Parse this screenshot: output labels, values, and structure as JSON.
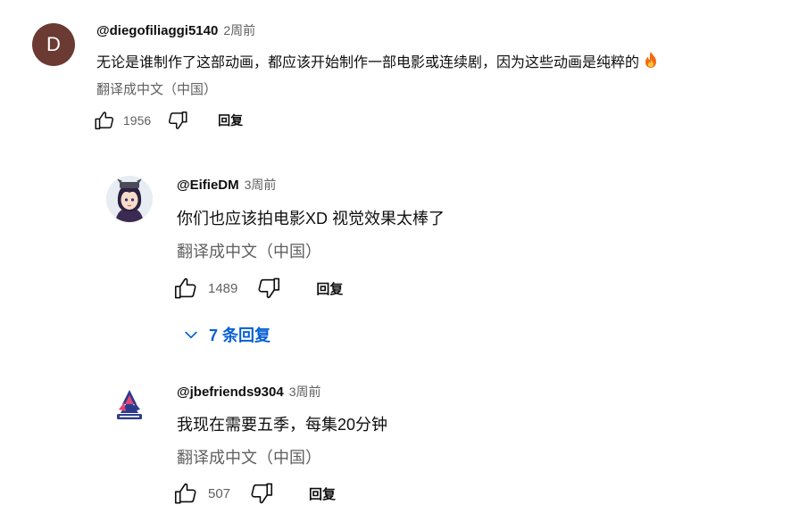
{
  "comments": [
    {
      "avatar_letter": "D",
      "avatar_color": "#6b3a33",
      "author": "@diegofiliaggi5140",
      "time": "2周前",
      "text": "无论是谁制作了这部动画，都应该开始制作一部电影或连续剧，因为这些动画是纯粹的",
      "emoji": "fire-emoji",
      "translate": "翻译成中文（中国）",
      "likes": "1956",
      "reply_label": "回复"
    },
    {
      "author": "@EifieDM",
      "time": "3周前",
      "text": "你们也应该拍电影XD 视觉效果太棒了",
      "translate": "翻译成中文（中国）",
      "likes": "1489",
      "reply_label": "回复",
      "replies_toggle": "7 条回复"
    },
    {
      "author": "@jbefriends9304",
      "time": "3周前",
      "text": "我现在需要五季，每集20分钟",
      "translate": "翻译成中文（中国）",
      "likes": "507",
      "reply_label": "回复"
    }
  ],
  "colors": {
    "link_blue": "#065fd4",
    "secondary_text": "#606060",
    "primary_text": "#0f0f0f"
  },
  "icons": {
    "like": "thumbs-up-icon",
    "dislike": "thumbs-down-icon",
    "expand": "chevron-down-icon"
  }
}
